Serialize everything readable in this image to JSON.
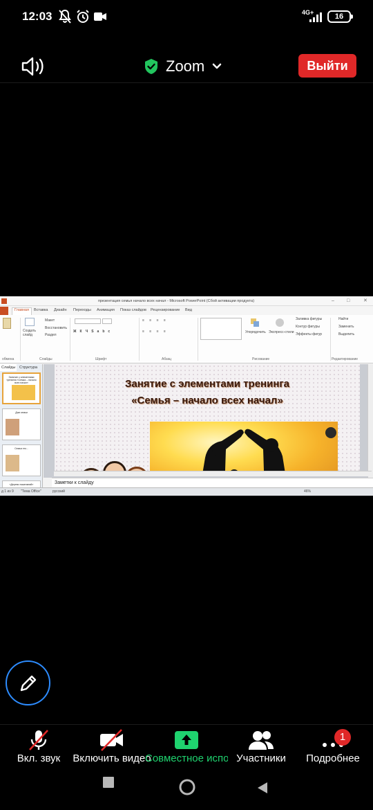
{
  "status_bar": {
    "time": "12:03",
    "network": "4G+",
    "battery": "16",
    "icons": [
      "mute-notifications-icon",
      "alarm-icon",
      "video-recording-icon",
      "signal-icon",
      "battery-icon"
    ]
  },
  "header": {
    "meeting_title": "Zoom",
    "leave_label": "Выйти",
    "icons": [
      "speaker-icon",
      "shield-check-icon",
      "chevron-down-icon"
    ]
  },
  "shared_screen": {
    "window_title": "презентация семья начало всех начал - Microsoft PowerPoint (Сбой активации продукта)",
    "ribbon_tabs": [
      "Главная",
      "Вставка",
      "Дизайн",
      "Переходы",
      "Анимация",
      "Показ слайдов",
      "Рецензирование",
      "Вид"
    ],
    "ribbon": {
      "clipboard_label": "обмена",
      "slides_label": "Слайды",
      "font_label": "Шрифт",
      "paragraph_label": "Абзац",
      "drawing_label": "Рисование",
      "editing_label": "Редактирование",
      "maket": "Макет",
      "restore": "Восстановить",
      "section": "Раздел",
      "create_slide": "Создать слайд",
      "arrange": "Упорядочить",
      "express_styles": "Экспресс-стили",
      "fill": "Заливка фигуры",
      "outline": "Контур фигуры",
      "effects": "Эффекты фигур",
      "find": "Найти",
      "replace": "Заменить",
      "select": "Выделить"
    },
    "panel_tabs": [
      "Слайды",
      "Структура"
    ],
    "thumbnails": [
      "Занятие с элементами тренинга «Семья – начало всех начал»",
      "Дом семьи",
      "Семья это...",
      "«Дерево пожеланий»"
    ],
    "slide": {
      "title_line1": "Занятие с элементами тренинга",
      "title_line2": "«Семья – начало всех начал»"
    },
    "notes_placeholder": "Заметки к слайду",
    "status": {
      "slide_counter": "д 1 из 9",
      "theme": "\"Тема Office\"",
      "language": "русский",
      "zoom": "46%"
    }
  },
  "toolbar": {
    "items": [
      {
        "label": "Вкл. звук",
        "icon": "microphone-muted-icon"
      },
      {
        "label": "Включить видео",
        "icon": "camera-off-icon"
      },
      {
        "label": "Совместное использование",
        "icon": "share-screen-icon"
      },
      {
        "label": "Участники",
        "icon": "participants-icon"
      },
      {
        "label": "Подробнее",
        "icon": "more-icon"
      }
    ],
    "more_badge": "1"
  },
  "colors": {
    "leave_button": "#e02828",
    "share_green": "#1fd36f",
    "pencil_blue": "#2d8cff",
    "shield_green": "#22c55e"
  }
}
